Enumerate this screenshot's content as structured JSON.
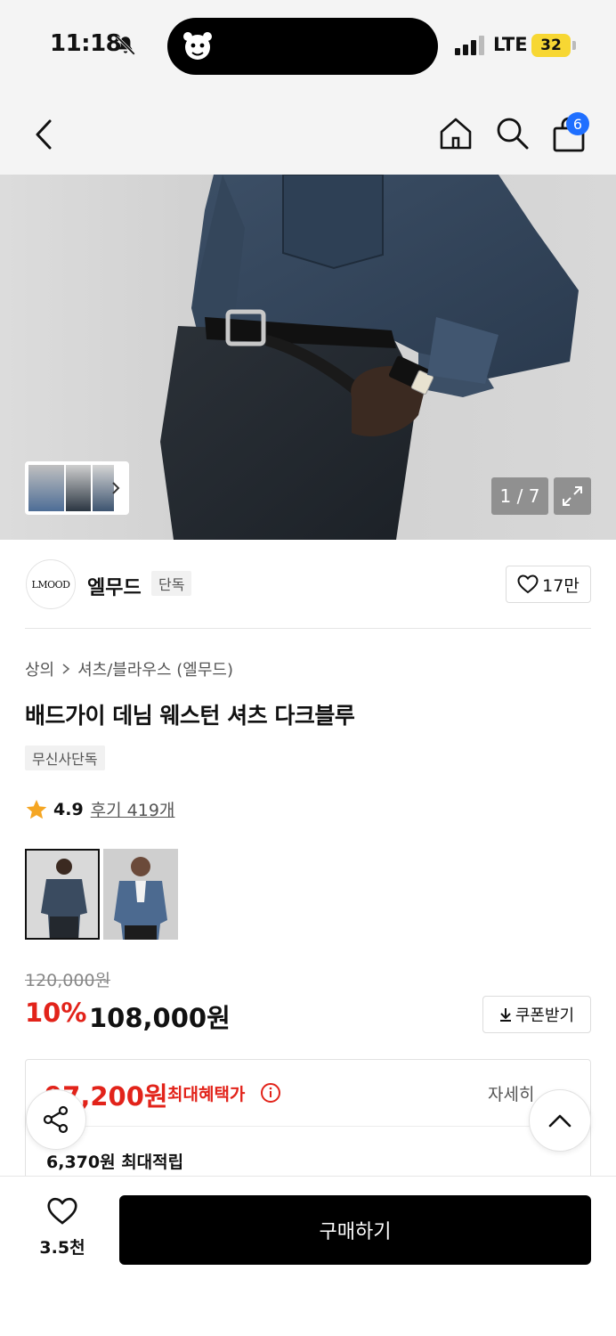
{
  "status_bar": {
    "time": "11:18",
    "network": "LTE",
    "battery": "32"
  },
  "nav": {
    "cart_count": "6"
  },
  "gallery": {
    "counter": "1 / 7"
  },
  "brand": {
    "logo_text": "LMOOD",
    "name": "엘무드",
    "tag": "단독",
    "like_count": "17만"
  },
  "product": {
    "breadcrumb": [
      "상의",
      "셔츠/블라우스 (엘무드)"
    ],
    "title": "배드가이 데님 웨스턴 셔츠 다크블루",
    "tag": "무신사단독",
    "rating": "4.9",
    "review_label": "후기 419개",
    "original_price": "120,000원",
    "discount": "10%",
    "price": "108,000원",
    "coupon_label": "쿠폰받기"
  },
  "benefit": {
    "max_price": "97,200원",
    "max_label": "최대혜택가",
    "detail_label": "자세히",
    "points": "6,370원 최대적립"
  },
  "bottom": {
    "wish_count": "3.5천",
    "buy_label": "구매하기"
  },
  "colors": {
    "accent_red": "#e2231a",
    "badge_blue": "#1f6fff",
    "star": "#f5a623",
    "battery": "#f7d733"
  }
}
